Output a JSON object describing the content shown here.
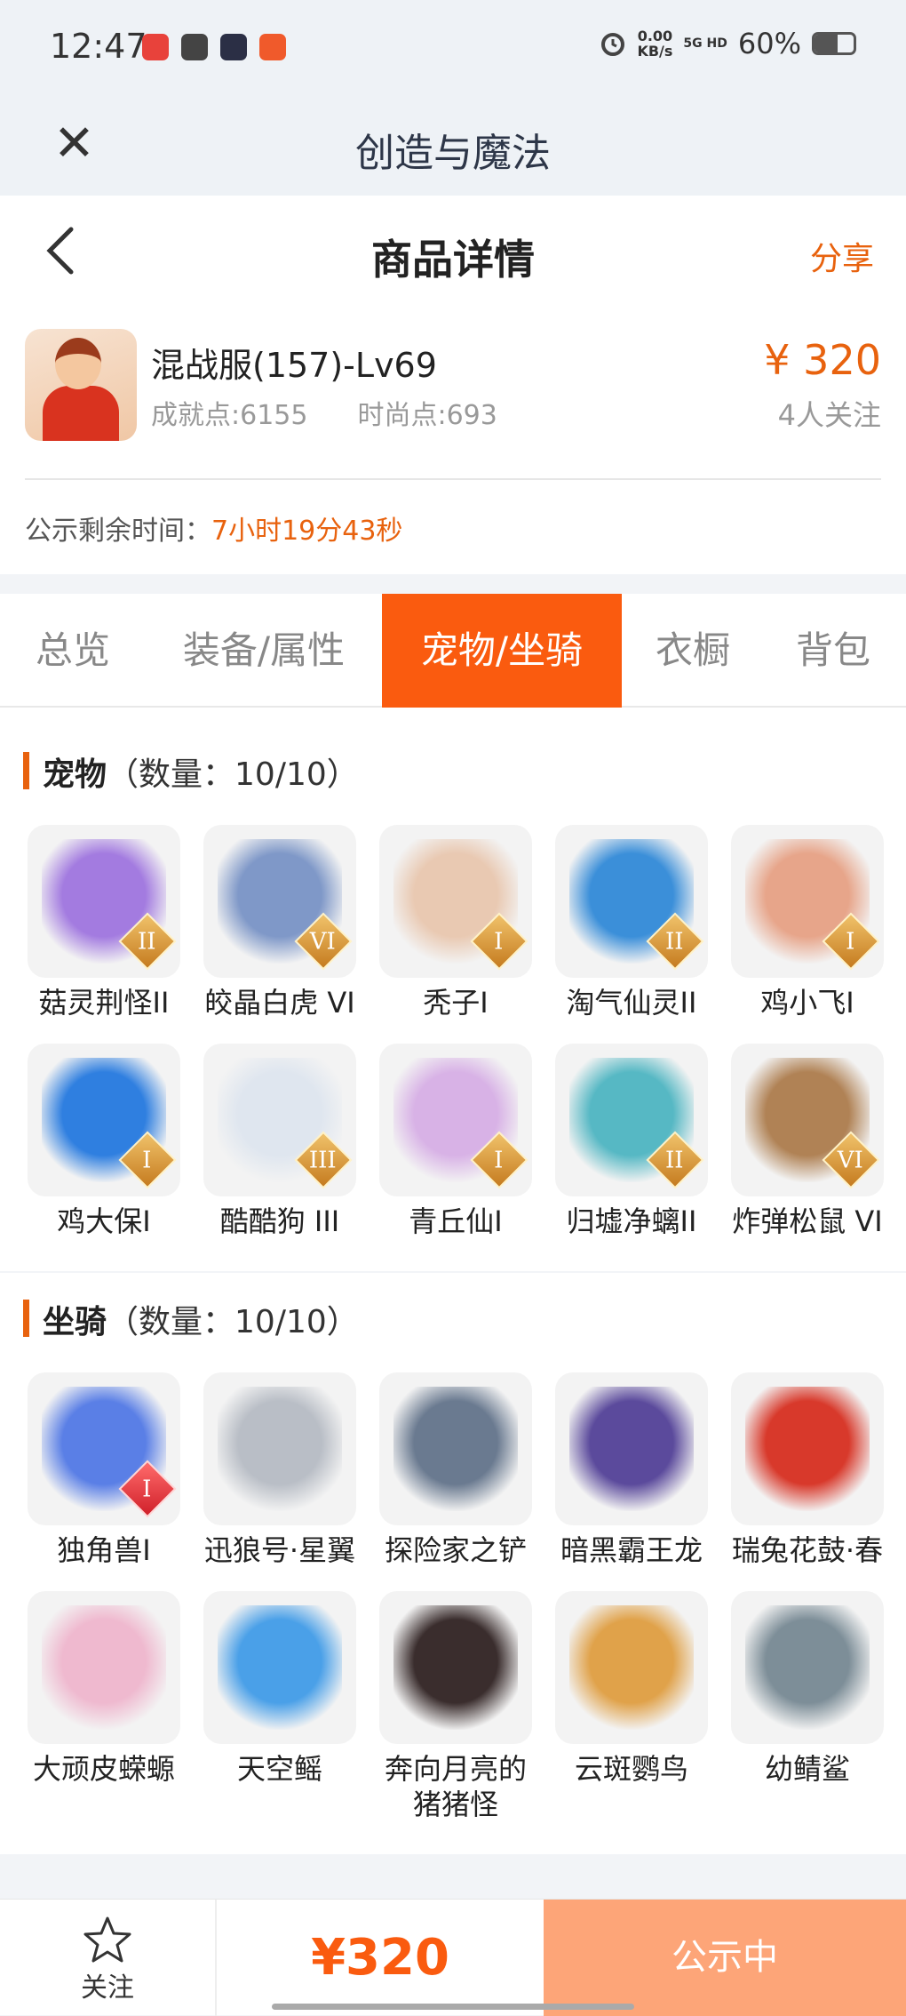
{
  "status": {
    "time": "12:47",
    "net_speed": "0.00",
    "net_unit": "KB/s",
    "signal": "5G HD",
    "battery": "60%",
    "battery_level": 0.6
  },
  "appbar": {
    "title": "创造与魔法"
  },
  "header": {
    "title": "商品详情",
    "share": "分享"
  },
  "product": {
    "name": "混战服(157)-Lv69",
    "achievement": "成就点:6155",
    "fashion": "时尚点:693",
    "price": "¥ 320",
    "followers": "4人关注"
  },
  "notice": {
    "label": "公示剩余时间：",
    "value": "7小时19分43秒"
  },
  "tabs": [
    "总览",
    "装备/属性",
    "宠物/坐骑",
    "衣橱",
    "背包"
  ],
  "active_tab": 2,
  "pets": {
    "title": "宠物",
    "count": "（数量：10/10）",
    "items": [
      {
        "name": "菇灵荆怪II",
        "badge": "II",
        "color": "#a37be0"
      },
      {
        "name": "皎晶白虎 VI",
        "badge": "VI",
        "color": "#7f98c8"
      },
      {
        "name": "秃子I",
        "badge": "I",
        "color": "#e9c9b2"
      },
      {
        "name": "淘气仙灵II",
        "badge": "II",
        "color": "#3b8fd9"
      },
      {
        "name": "鸡小飞I",
        "badge": "I",
        "color": "#e7a58a"
      },
      {
        "name": "鸡大保I",
        "badge": "I",
        "color": "#2f7fe0"
      },
      {
        "name": "酷酷狗 III",
        "badge": "III",
        "color": "#dfe6ef"
      },
      {
        "name": "青丘仙I",
        "badge": "I",
        "color": "#d8b2e6"
      },
      {
        "name": "归墟净螭II",
        "badge": "II",
        "color": "#56b8c4"
      },
      {
        "name": "炸弹松鼠 VI",
        "badge": "VI",
        "color": "#b08255"
      }
    ]
  },
  "mounts": {
    "title": "坐骑",
    "count": "（数量：10/10）",
    "items": [
      {
        "name": "独角兽I",
        "badge": "I",
        "color": "#5a7fe6"
      },
      {
        "name": "迅狼号·星翼",
        "badge": "",
        "color": "#b9bec6"
      },
      {
        "name": "探险家之铲",
        "badge": "",
        "color": "#6a7a90"
      },
      {
        "name": "暗黑霸王龙",
        "badge": "",
        "color": "#5b4a9c"
      },
      {
        "name": "瑞兔花鼓·春",
        "badge": "",
        "color": "#d8392b"
      },
      {
        "name": "大顽皮蝾螈",
        "badge": "",
        "color": "#efb9cf"
      },
      {
        "name": "天空鳐",
        "badge": "",
        "color": "#4aa0e8"
      },
      {
        "name": "奔向月亮的猪猪怪",
        "badge": "",
        "color": "#3a2d2d"
      },
      {
        "name": "云斑鹦鸟",
        "badge": "",
        "color": "#e0a24a"
      },
      {
        "name": "幼鲭鲨",
        "badge": "",
        "color": "#7d8e98"
      }
    ]
  },
  "bottom": {
    "follow": "关注",
    "price": "¥320",
    "cta": "公示中"
  }
}
